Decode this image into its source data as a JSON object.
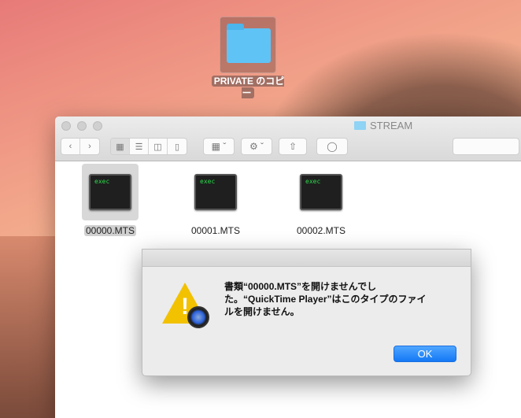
{
  "desktop": {
    "folder_label": "PRIVATE のコピー"
  },
  "window": {
    "title": "STREAM",
    "files": [
      {
        "name": "00000.MTS",
        "icon_text": "exec",
        "selected": true
      },
      {
        "name": "00001.MTS",
        "icon_text": "exec",
        "selected": false
      },
      {
        "name": "00002.MTS",
        "icon_text": "exec",
        "selected": false
      }
    ]
  },
  "dialog": {
    "message_lines": [
      "書類“00000.MTS”を開けませんでし",
      "た。“QuickTime Player”はこのタイプのファイ",
      "ルを開けません。"
    ],
    "ok_label": "OK"
  }
}
